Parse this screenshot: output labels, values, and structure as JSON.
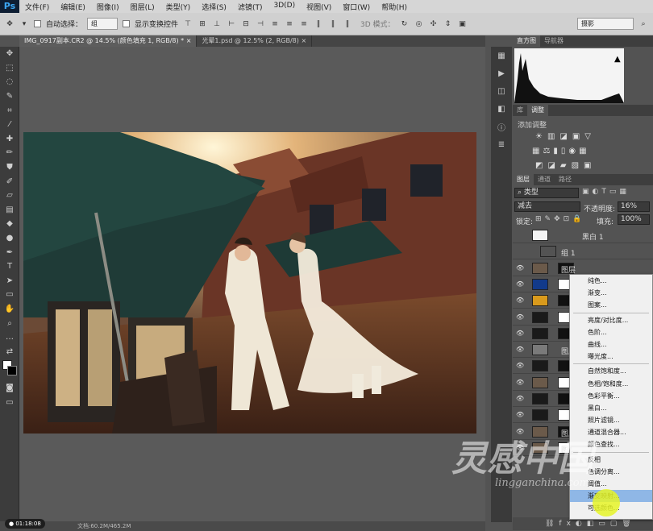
{
  "app": {
    "logo": "Ps"
  },
  "menu": [
    "文件(F)",
    "编辑(E)",
    "图像(I)",
    "图层(L)",
    "类型(Y)",
    "选择(S)",
    "滤镜(T)",
    "3D(D)",
    "视图(V)",
    "窗口(W)",
    "帮助(H)"
  ],
  "options": {
    "auto_select_label": "自动选择：",
    "auto_select_value": "组",
    "transform_label": "显示变换控件",
    "mode_3d": "3D 模式：",
    "workspace": "摄影"
  },
  "tabs": [
    {
      "label": "IMG_0917副本.CR2 @ 14.5% (颜色填充 1, RGB/8) *",
      "active": true
    },
    {
      "label": "光晕1.psd @ 12.5% (2, RGB/8)",
      "active": false
    }
  ],
  "status": {
    "doc": "文档:60.2M/465.2M",
    "timer": "01:18:08"
  },
  "panels": {
    "histogram_tabs": [
      "直方图",
      "导航器"
    ],
    "adjust_tabs": [
      "库",
      "调整"
    ],
    "add_adjust_label": "添加调整",
    "layers_tabs": [
      "图层",
      "通道",
      "路径"
    ],
    "kind_filter": "类型",
    "blend_mode": "减去",
    "opacity_label": "不透明度:",
    "opacity_value": "16%",
    "lock_label": "锁定:",
    "fill_label": "填充:",
    "fill_value": "100%"
  },
  "layers": [
    {
      "name": "黑白 1",
      "type": "adjust"
    },
    {
      "name": "组 1",
      "type": "group"
    },
    {
      "name": "图层",
      "type": "photo"
    },
    {
      "name": "",
      "type": "fill-blue"
    },
    {
      "name": "",
      "type": "fill-orange"
    },
    {
      "name": "",
      "type": "mask"
    },
    {
      "name": "",
      "type": "mask"
    },
    {
      "name": "图层",
      "type": "gray"
    },
    {
      "name": "",
      "type": "mask"
    },
    {
      "name": "",
      "type": "photo"
    },
    {
      "name": "",
      "type": "mask"
    },
    {
      "name": "",
      "type": "mask"
    },
    {
      "name": "图层",
      "type": "photo"
    },
    {
      "name": "图层",
      "type": "photo"
    }
  ],
  "context_menu": {
    "groups": [
      [
        "纯色...",
        "渐变...",
        "图案..."
      ],
      [
        "亮度/对比度...",
        "色阶...",
        "曲线...",
        "曝光度..."
      ],
      [
        "自然饱和度...",
        "色相/饱和度...",
        "色彩平衡...",
        "黑白...",
        "照片滤镜...",
        "通道混合器...",
        "颜色查找..."
      ],
      [
        "反相",
        "色调分离...",
        "阈值...",
        "渐变映射...",
        "可选颜色..."
      ]
    ],
    "highlighted": "渐变映射..."
  },
  "watermark": {
    "big": "灵感中国",
    "small": "lingganchina.com"
  }
}
